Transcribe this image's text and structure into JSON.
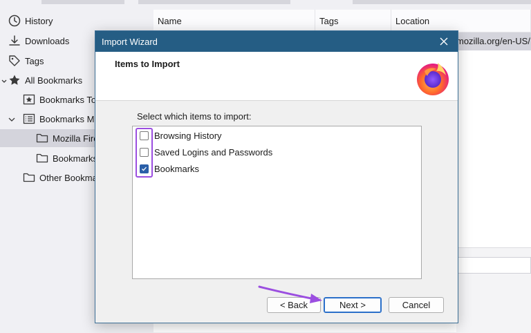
{
  "library": {
    "sidebar": {
      "items": [
        {
          "label": "History",
          "icon": "clock-icon"
        },
        {
          "label": "Downloads",
          "icon": "download-icon"
        },
        {
          "label": "Tags",
          "icon": "tag-icon"
        },
        {
          "label": "All Bookmarks",
          "icon": "star-icon"
        },
        {
          "label": "Bookmarks To",
          "icon": "star-box-icon"
        },
        {
          "label": "Bookmarks Me",
          "icon": "menu-list-icon"
        },
        {
          "label": "Mozilla Fire",
          "icon": "folder-icon"
        },
        {
          "label": "Bookmarks",
          "icon": "folder-icon"
        },
        {
          "label": "Other Bookma",
          "icon": "folder-icon"
        }
      ]
    },
    "columns": [
      "Name",
      "Tags",
      "Location"
    ],
    "row_location": "mozilla.org/en-US/"
  },
  "dialog": {
    "title": "Import Wizard",
    "heading": "Items to Import",
    "prompt": "Select which items to import:",
    "options": [
      {
        "label": "Browsing History",
        "checked": false
      },
      {
        "label": "Saved Logins and Passwords",
        "checked": false
      },
      {
        "label": "Bookmarks",
        "checked": true
      }
    ],
    "buttons": {
      "back": "< Back",
      "next": "Next >",
      "cancel": "Cancel"
    }
  },
  "colors": {
    "titlebar": "#255d84",
    "highlight": "#9b4ee0",
    "checkbox_checked": "#2a5fa8"
  }
}
